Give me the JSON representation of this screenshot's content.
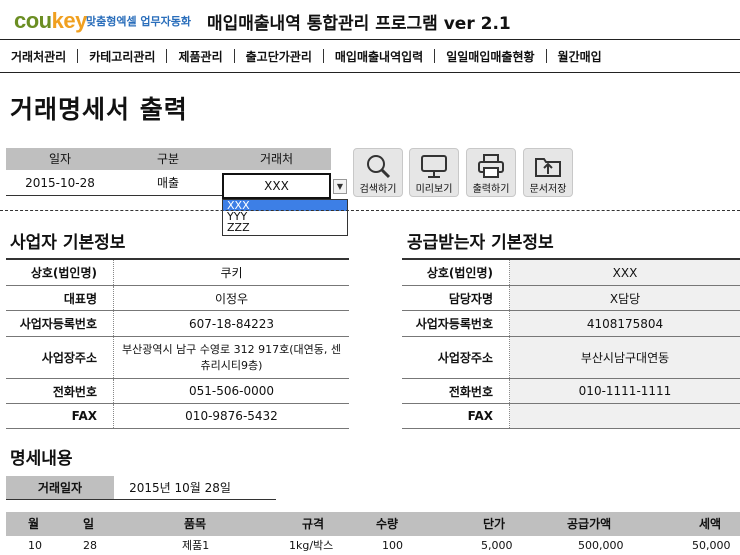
{
  "brand": {
    "logo_part1": "cou",
    "logo_part2": "key",
    "tagline": "맞춤형엑셀 업무자동화",
    "title": "매입매출내역 통합관리 프로그램 ver 2.1"
  },
  "menu": [
    "거래처관리",
    "카테고리관리",
    "제품관리",
    "출고단가관리",
    "매입매출내역입력",
    "일일매입매출현황",
    "월간매입"
  ],
  "page_title": "거래명세서 출력",
  "form": {
    "headers": [
      "일자",
      "구분",
      "거래처"
    ],
    "date": "2015-10-28",
    "type": "매출",
    "vendor": "XXX",
    "dropdown_options": [
      "XXX",
      "YYY",
      "ZZZ"
    ],
    "selected_option": "XXX"
  },
  "buttons": {
    "search": "검색하기",
    "preview": "미리보기",
    "print": "출력하기",
    "save": "문서저장"
  },
  "supplier": {
    "title": "사업자 기본정보",
    "rows": [
      {
        "label": "상호(법인명)",
        "value": "쿠키"
      },
      {
        "label": "대표명",
        "value": "이정우"
      },
      {
        "label": "사업자등록번호",
        "value": "607-18-84223"
      },
      {
        "label": "사업장주소",
        "value": "부산광역시 남구 수영로 312 917호(대연동, 센츄리시티9층)"
      },
      {
        "label": "전화번호",
        "value": "051-506-0000"
      },
      {
        "label": "FAX",
        "value": "010-9876-5432"
      }
    ]
  },
  "recipient": {
    "title": "공급받는자 기본정보",
    "rows": [
      {
        "label": "상호(법인명)",
        "value": "XXX"
      },
      {
        "label": "담당자명",
        "value": "X담당"
      },
      {
        "label": "사업자등록번호",
        "value": "4108175804"
      },
      {
        "label": "사업장주소",
        "value": "부산시남구대연동"
      },
      {
        "label": "전화번호",
        "value": "010-1111-1111"
      },
      {
        "label": "FAX",
        "value": ""
      }
    ]
  },
  "detail": {
    "title": "명세내용",
    "date_label": "거래일자",
    "date_value": "2015년 10월 28일",
    "columns": [
      "월",
      "일",
      "품목",
      "규격",
      "수량",
      "단가",
      "공급가액",
      "세액"
    ],
    "rows": [
      {
        "month": "10",
        "day": "28",
        "item": "제품1",
        "spec": "1kg/박스",
        "qty": "100",
        "unit_price": "5,000",
        "supply": "500,000",
        "tax": "50,000"
      }
    ]
  }
}
